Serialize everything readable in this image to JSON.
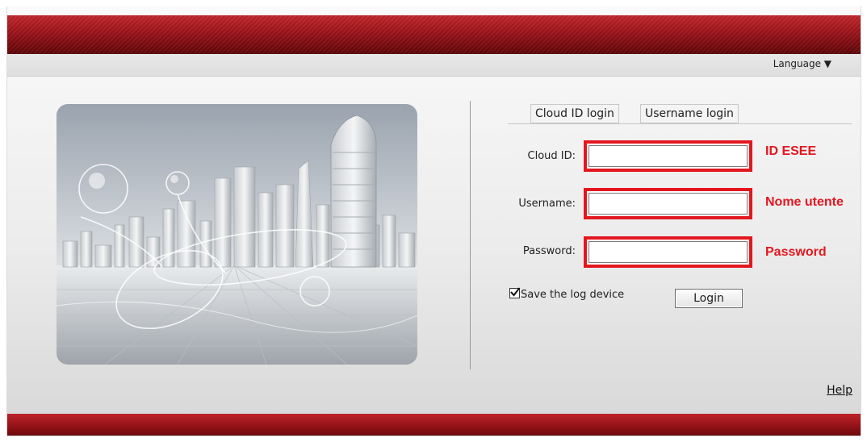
{
  "header": {
    "language_label": "Language ▼",
    "brand_color": "#9b1016"
  },
  "hero": {
    "image": "city-skyline-illustration"
  },
  "tabs": [
    {
      "label": "Cloud ID login"
    },
    {
      "label": "Username login"
    }
  ],
  "form": {
    "cloud_id": {
      "label": "Cloud ID:",
      "value": "",
      "annotation": "ID ESEE"
    },
    "username": {
      "label": "Username:",
      "value": "",
      "annotation": "Nome utente"
    },
    "password": {
      "label": "Password:",
      "value": "",
      "annotation": "Password"
    },
    "save_device": {
      "label": "Save the log device",
      "checked": true
    },
    "login_label": "Login"
  },
  "footer": {
    "help_label": "Help"
  },
  "colors": {
    "highlight": "#e3171f",
    "annotation_text": "#e3171f"
  }
}
